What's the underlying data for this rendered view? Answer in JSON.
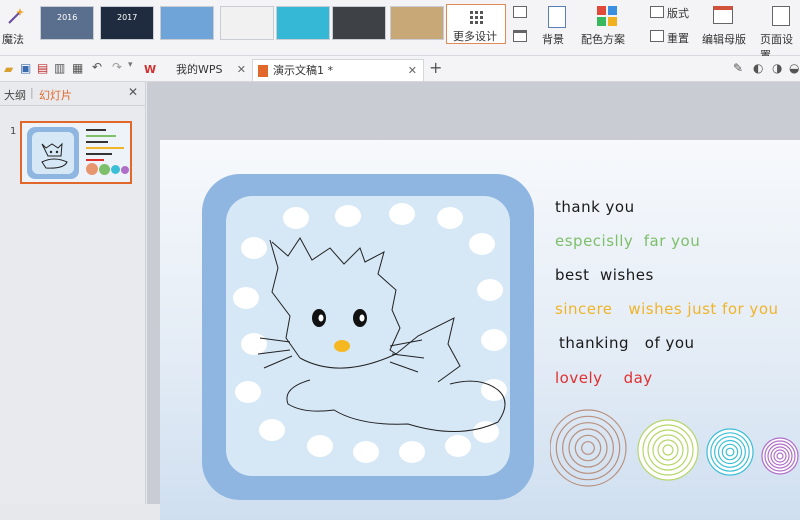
{
  "ribbon": {
    "magic_label": "魔法",
    "more_design_label": "更多设计",
    "background_label": "背景",
    "color_scheme_label": "配色方案",
    "layout_label": "版式",
    "reset_label": "重置",
    "edit_master_label": "编辑母版",
    "page_setup_label": "页面设置",
    "templates": [
      {
        "label": "2016",
        "bg": "#5a6e8e"
      },
      {
        "label": "2017",
        "bg": "#1f2c3f"
      },
      {
        "label": "",
        "bg": "#6fa4d8"
      },
      {
        "label": "",
        "bg": "#f1f1f1"
      },
      {
        "label": "",
        "bg": "#35b8d6"
      },
      {
        "label": "",
        "bg": "#3e4247"
      },
      {
        "label": "",
        "bg": "#c9a877"
      }
    ]
  },
  "tabs": {
    "home": "我的WPS",
    "document": "演示文稿1 *"
  },
  "panel": {
    "outline_tab": "大纲",
    "slides_tab": "幻灯片",
    "slide_number": "1"
  },
  "slide": {
    "lines": [
      {
        "text": "thank you",
        "color": "#1a1a1a"
      },
      {
        "text": "especislly  far you",
        "color": "#7dbf6a"
      },
      {
        "text": "best  wishes",
        "color": "#1a1a1a"
      },
      {
        "text": "sincere   wishes just for you",
        "color": "#f0b429"
      },
      {
        "text": "thanking   of you",
        "color": "#1a1a1a"
      },
      {
        "text": "lovely    day",
        "color": "#e03030"
      }
    ],
    "circle_colors": [
      "#b8907e",
      "#b5d66a",
      "#3bbfd6",
      "#b06ec8"
    ],
    "frame_color": "#8fb6e0",
    "inner_color": "#d6e7f6"
  },
  "colors": {
    "accent": "#e2672a"
  }
}
